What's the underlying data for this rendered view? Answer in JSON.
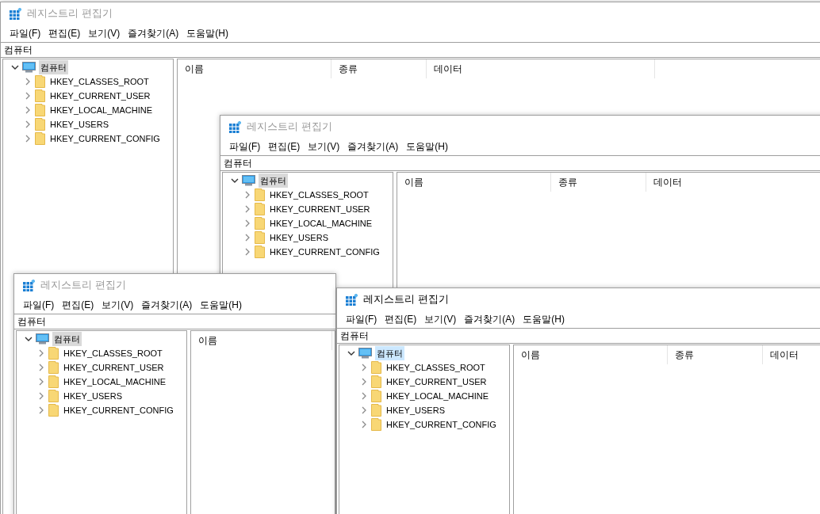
{
  "windows": [
    {
      "title": "레지스트리 편집기",
      "active": false,
      "menu": [
        "파일(F)",
        "편집(E)",
        "보기(V)",
        "즐겨찾기(A)",
        "도움말(H)"
      ],
      "address": "컴퓨터",
      "columns": [
        "이름",
        "종류",
        "데이터"
      ],
      "tree": {
        "label": "컴퓨터",
        "expanded": true,
        "selected": true,
        "children": [
          {
            "label": "HKEY_CLASSES_ROOT",
            "expanded": false,
            "selected": false
          },
          {
            "label": "HKEY_CURRENT_USER",
            "expanded": false,
            "selected": false
          },
          {
            "label": "HKEY_LOCAL_MACHINE",
            "expanded": false,
            "selected": false
          },
          {
            "label": "HKEY_USERS",
            "expanded": false,
            "selected": false
          },
          {
            "label": "HKEY_CURRENT_CONFIG",
            "expanded": false,
            "selected": false
          }
        ]
      }
    },
    {
      "title": "레지스트리 편집기",
      "active": false,
      "menu": [
        "파일(F)",
        "편집(E)",
        "보기(V)",
        "즐겨찾기(A)",
        "도움말(H)"
      ],
      "address": "컴퓨터",
      "columns": [
        "이름",
        "종류",
        "데이터"
      ],
      "tree": {
        "label": "컴퓨터",
        "expanded": true,
        "selected": true,
        "children": [
          {
            "label": "HKEY_CLASSES_ROOT",
            "expanded": false,
            "selected": false
          },
          {
            "label": "HKEY_CURRENT_USER",
            "expanded": false,
            "selected": false
          },
          {
            "label": "HKEY_LOCAL_MACHINE",
            "expanded": false,
            "selected": false
          },
          {
            "label": "HKEY_USERS",
            "expanded": false,
            "selected": false
          },
          {
            "label": "HKEY_CURRENT_CONFIG",
            "expanded": false,
            "selected": false
          }
        ]
      }
    },
    {
      "title": "레지스트리 편집기",
      "active": false,
      "menu": [
        "파일(F)",
        "편집(E)",
        "보기(V)",
        "즐겨찾기(A)",
        "도움말(H)"
      ],
      "address": "컴퓨터",
      "columns": [
        "이름"
      ],
      "tree": {
        "label": "컴퓨터",
        "expanded": true,
        "selected": true,
        "children": [
          {
            "label": "HKEY_CLASSES_ROOT",
            "expanded": false,
            "selected": false
          },
          {
            "label": "HKEY_CURRENT_USER",
            "expanded": false,
            "selected": false
          },
          {
            "label": "HKEY_LOCAL_MACHINE",
            "expanded": false,
            "selected": false
          },
          {
            "label": "HKEY_USERS",
            "expanded": false,
            "selected": false
          },
          {
            "label": "HKEY_CURRENT_CONFIG",
            "expanded": false,
            "selected": false
          }
        ]
      }
    },
    {
      "title": "레지스트리 편집기",
      "active": true,
      "menu": [
        "파일(F)",
        "편집(E)",
        "보기(V)",
        "즐겨찾기(A)",
        "도움말(H)"
      ],
      "address": "컴퓨터",
      "columns": [
        "이름",
        "종류",
        "데이터"
      ],
      "tree": {
        "label": "컴퓨터",
        "expanded": true,
        "selected": true,
        "children": [
          {
            "label": "HKEY_CLASSES_ROOT",
            "expanded": false,
            "selected": false
          },
          {
            "label": "HKEY_CURRENT_USER",
            "expanded": false,
            "selected": false
          },
          {
            "label": "HKEY_LOCAL_MACHINE",
            "expanded": false,
            "selected": false
          },
          {
            "label": "HKEY_USERS",
            "expanded": false,
            "selected": false
          },
          {
            "label": "HKEY_CURRENT_CONFIG",
            "expanded": false,
            "selected": false
          }
        ]
      }
    }
  ]
}
